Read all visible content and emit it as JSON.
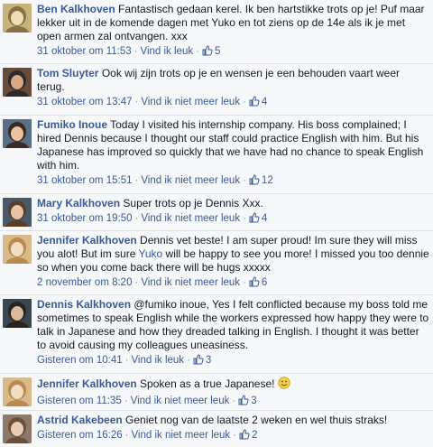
{
  "comments": [
    {
      "author": "Ben Kalkhoven",
      "parts": [
        {
          "text": "Fantastisch gedaan kerel. Ik ben hartstikke trots op je! Puf maar lekker uit in de komende dagen met Yuko en tot ziens op de 14e als ik je met open armen zal ontvangen. xxx"
        }
      ],
      "timestamp": "31 oktober om 11:53",
      "like_label": "Vind ik leuk",
      "like_count": "5"
    },
    {
      "author": "Tom Sluyter",
      "parts": [
        {
          "text": "Ook wij zijn trots op je en wensen je een behouden vaart weer terug."
        }
      ],
      "timestamp": "31 oktober om 13:47",
      "like_label": "Vind ik niet meer leuk",
      "like_count": "4"
    },
    {
      "author": "Fumiko Inoue",
      "parts": [
        {
          "text": "Today I visited his internship company. His boss complained; I hired Dennis because I thought our staff could practice English with him. But his Japanese has improved so quickly that we have had no chance to speak English with him."
        }
      ],
      "timestamp": "31 oktober om 15:51",
      "like_label": "Vind ik niet meer leuk",
      "like_count": "12"
    },
    {
      "author": "Mary Kalkhoven",
      "parts": [
        {
          "text": "Super trots op je Dennis Xxx."
        }
      ],
      "timestamp": "31 oktober om 19:50",
      "like_label": "Vind ik niet meer leuk",
      "like_count": "4"
    },
    {
      "author": "Jennifer Kalkhoven",
      "parts": [
        {
          "text": "Dennis vet beste! I am super proud! Im sure they will miss you alot! But im sure "
        },
        {
          "text": "Yuko",
          "mention": true
        },
        {
          "text": " will be happy to see you more! I missed you too dennie so when you come back there will be hugs xxxxx"
        }
      ],
      "timestamp": "2 november om 8:20",
      "like_label": "Vind ik niet meer leuk",
      "like_count": "6"
    },
    {
      "author": "Dennis Kalkhoven",
      "parts": [
        {
          "text": "@fumiko inoue, Yes I felt conflicted because my boss told me sometimes to speak English while the workers expressed how happy they were to talk in Japanese and how they dreaded talking in English. I thought it was better to avoid causing my colleagues uneasiness."
        }
      ],
      "timestamp": "Gisteren om 10:41",
      "like_label": "Vind ik leuk",
      "like_count": "3"
    },
    {
      "author": "Jennifer Kalkhoven",
      "parts": [
        {
          "text": "Spoken as a true Japanese!"
        }
      ],
      "emoji": "smile-icon",
      "timestamp": "Gisteren om 11:35",
      "like_label": "Vind ik niet meer leuk",
      "like_count": "3"
    },
    {
      "author": "Astrid Kakebeen",
      "parts": [
        {
          "text": "Geniet nog van de laatste 2 weken en wel thuis straks!"
        }
      ],
      "timestamp": "Gisteren om 16:26",
      "like_label": "Vind ik niet meer leuk",
      "like_count": "2"
    }
  ],
  "separator": "·",
  "colors": {
    "link": "#3b5998",
    "meta": "#9197a3",
    "text": "#141823",
    "background": "#f6f7f9",
    "divider": "#e1e2e3"
  }
}
